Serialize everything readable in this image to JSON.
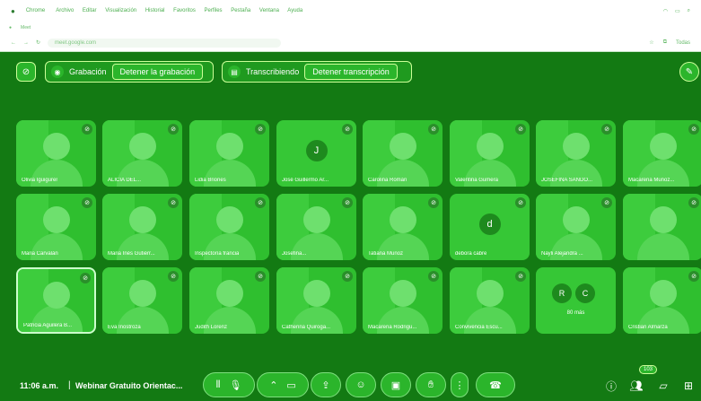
{
  "os_menu": {
    "app": "Chrome",
    "items": [
      "Archivo",
      "Editar",
      "Visualización",
      "Historial",
      "Favoritos",
      "Perfiles",
      "Pestaña",
      "Ventana",
      "Ayuda"
    ]
  },
  "browser": {
    "url": "meet.google.com",
    "tab_label": "Meet",
    "right_label": "Todas"
  },
  "status_bar": {
    "recording_label": "Grabación",
    "stop_recording": "Detener la grabación",
    "transcribing_label": "Transcribiendo",
    "stop_transcription": "Detener transcripción"
  },
  "participants": [
    {
      "name": "Olivia Iguigurer"
    },
    {
      "name": "ALICIA DEL..."
    },
    {
      "name": "Lidia Briones"
    },
    {
      "name": "José Guillermo Ar...",
      "initial": "J"
    },
    {
      "name": "Carolina Román"
    },
    {
      "name": "Valentina Gumera"
    },
    {
      "name": "JOSEFINA SANDO..."
    },
    {
      "name": "Macarena Muñoz..."
    },
    {
      "name": "Maria Carvalán"
    },
    {
      "name": "Maria Inés Gutiérr..."
    },
    {
      "name": "Inspectoría francia"
    },
    {
      "name": "Josefina..."
    },
    {
      "name": "Tatiana Muñoz"
    },
    {
      "name": "debora cabre",
      "initial": "d"
    },
    {
      "name": "Nayli Alejandra ..."
    },
    {
      "name": ""
    },
    {
      "name": "Patricia Aguilera B..."
    },
    {
      "name": "Eva Inostroza"
    },
    {
      "name": "Judith Lorenz"
    },
    {
      "name": "Catherina Quiroga..."
    },
    {
      "name": "Macarena Rodrigu..."
    },
    {
      "name": "Convivencia Escu..."
    },
    {
      "name": "80 más",
      "more": [
        "R",
        "C"
      ]
    },
    {
      "name": "Cristian Almarza"
    }
  ],
  "bottom_bar": {
    "time": "11:06 a.m.",
    "separator": "|",
    "meeting_title": "Webinar Gratuito Orientac...",
    "participant_badge": "103"
  },
  "colors": {
    "background": "#137a13",
    "accent": "#2bb52b",
    "border": "#ccff99"
  }
}
